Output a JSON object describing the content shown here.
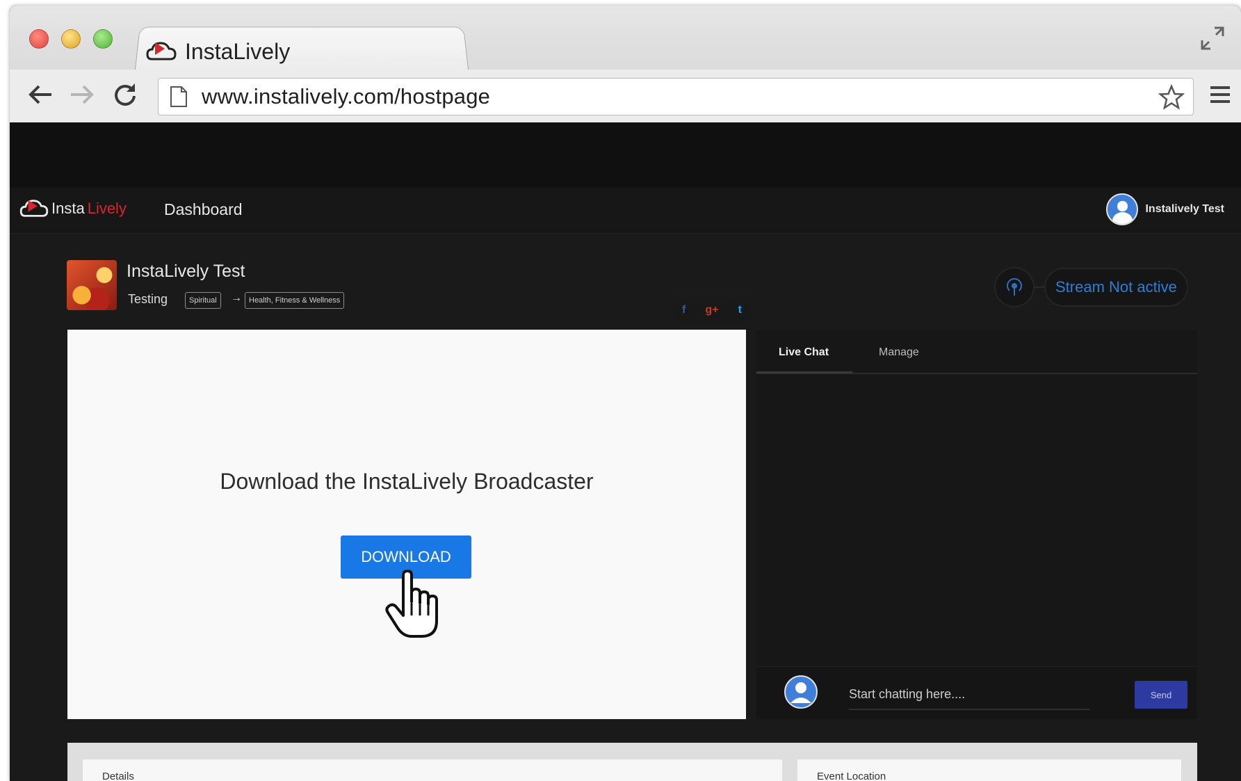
{
  "browser": {
    "tab_title": "InstaLively",
    "url": "www.instalively.com/hostpage"
  },
  "app": {
    "brand_part1": "Insta",
    "brand_part2": "Lively",
    "nav_dashboard": "Dashboard",
    "user_name": "Instalively Test"
  },
  "host": {
    "name": "InstaLively Test",
    "tagline": "Testing",
    "category": "Spiritual",
    "arrow": "→",
    "subcategory": "Health, Fitness & Wellness"
  },
  "social": {
    "facebook": "f",
    "googleplus": "g+",
    "twitter": "t"
  },
  "stream_status": "Stream Not active",
  "video": {
    "title": "Download the InstaLively Broadcaster",
    "download_label": "DOWNLOAD"
  },
  "chat": {
    "tab_live": "Live Chat",
    "tab_manage": "Manage",
    "placeholder": "Start chatting here....",
    "send_label": "Send"
  },
  "details": {
    "details_label": "Details",
    "location_label": "Event Location"
  },
  "colors": {
    "brand_red": "#d8262c",
    "accent_blue": "#1879e6",
    "send_blue": "#2d3aa0",
    "status_blue": "#2e7dd6"
  }
}
